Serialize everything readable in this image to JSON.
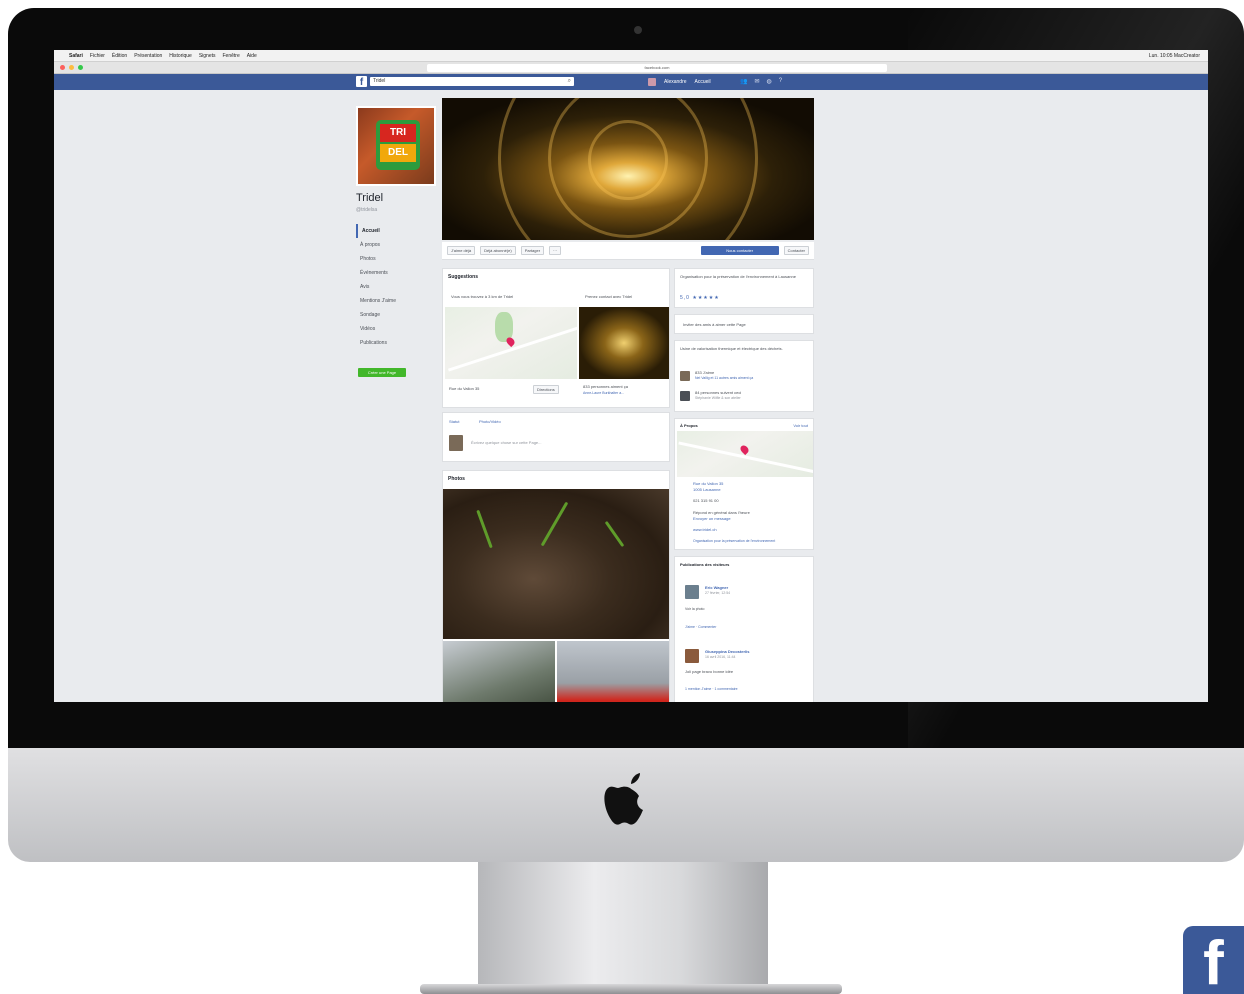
{
  "browser": {
    "menu": [
      "Safari",
      "Fichier",
      "Édition",
      "Présentation",
      "Historique",
      "Signets",
      "Fenêtre",
      "Aide"
    ],
    "status_right": "Lun. 10:05  MacCreator",
    "url": "facebook.com"
  },
  "fb": {
    "search_value": "Tridel",
    "user_name": "Alexandre",
    "home": "Accueil"
  },
  "page": {
    "logo_top": "TRI",
    "logo_bottom": "DEL",
    "name": "Tridel",
    "handle": "@tridelsa",
    "nav": [
      "Accueil",
      "À propos",
      "Photos",
      "Événements",
      "Avis",
      "Mentions J'aime",
      "Sondage",
      "Vidéos",
      "Publications"
    ],
    "create_page": "Créer une Page"
  },
  "actions": {
    "like": "J'aime déjà",
    "follow": "Déjà abonné(e)",
    "share": "Partager",
    "more": "···",
    "contact": "Nous contacter",
    "message": "Contacter"
  },
  "suggestions": {
    "title": "Suggestions",
    "near": "Vous vous trouvez à 3 km de Tridel",
    "contact": "Prenez contact avec Tridel",
    "address": "Rue du Vallon 35",
    "directions": "Directions",
    "likes": "833 personnes aiment ça",
    "likes_sub": "Anne-Laure Burkhalter a..."
  },
  "composer": {
    "status": "Statut",
    "photo": "Photo/Vidéo",
    "placeholder": "Écrivez quelque chose sur cette Page..."
  },
  "photos": {
    "title": "Photos"
  },
  "about": {
    "category": "Organisation pour la préservation de l'environnement à Lausanne",
    "rating": "5,0 ★★★★★",
    "invite": "Inviter des amis à aimer cette Page",
    "desc": "Usine de valorisation thermique et électrique des déchets.",
    "likes": "833 J'aime",
    "likes_sub": "Nel Vallig et 11 autres amis aiment ça",
    "followers": "84 personnes suivent ceci",
    "followers_sub": "Stéphanie Wilfle & son atelier"
  },
  "info": {
    "title": "À Propos",
    "see_all": "Voir tout",
    "address1": "Rue du Vallon 35",
    "address2": "1005 Lausanne",
    "phone": "021 315 91 00",
    "response": "Répond en général dans l'heure",
    "send_msg": "Envoyer un message",
    "website": "www.tridel.ch",
    "category": "Organisation pour la préservation de l'environnement"
  },
  "visitors": {
    "title": "Publications des visiteurs",
    "post1_author": "Eric Wagner",
    "post1_date": "27 février, 12:54",
    "post1_sub": "Voir la photo",
    "post1_actions": "J'aime · Commenter",
    "post2_author": "Giuseppina Decosterlis",
    "post2_date": "16 avril 2016, 11:44",
    "post2_text": "Joli page bravo bonne idée",
    "post2_actions": "1 mention J'aime · 1 commentaire"
  }
}
